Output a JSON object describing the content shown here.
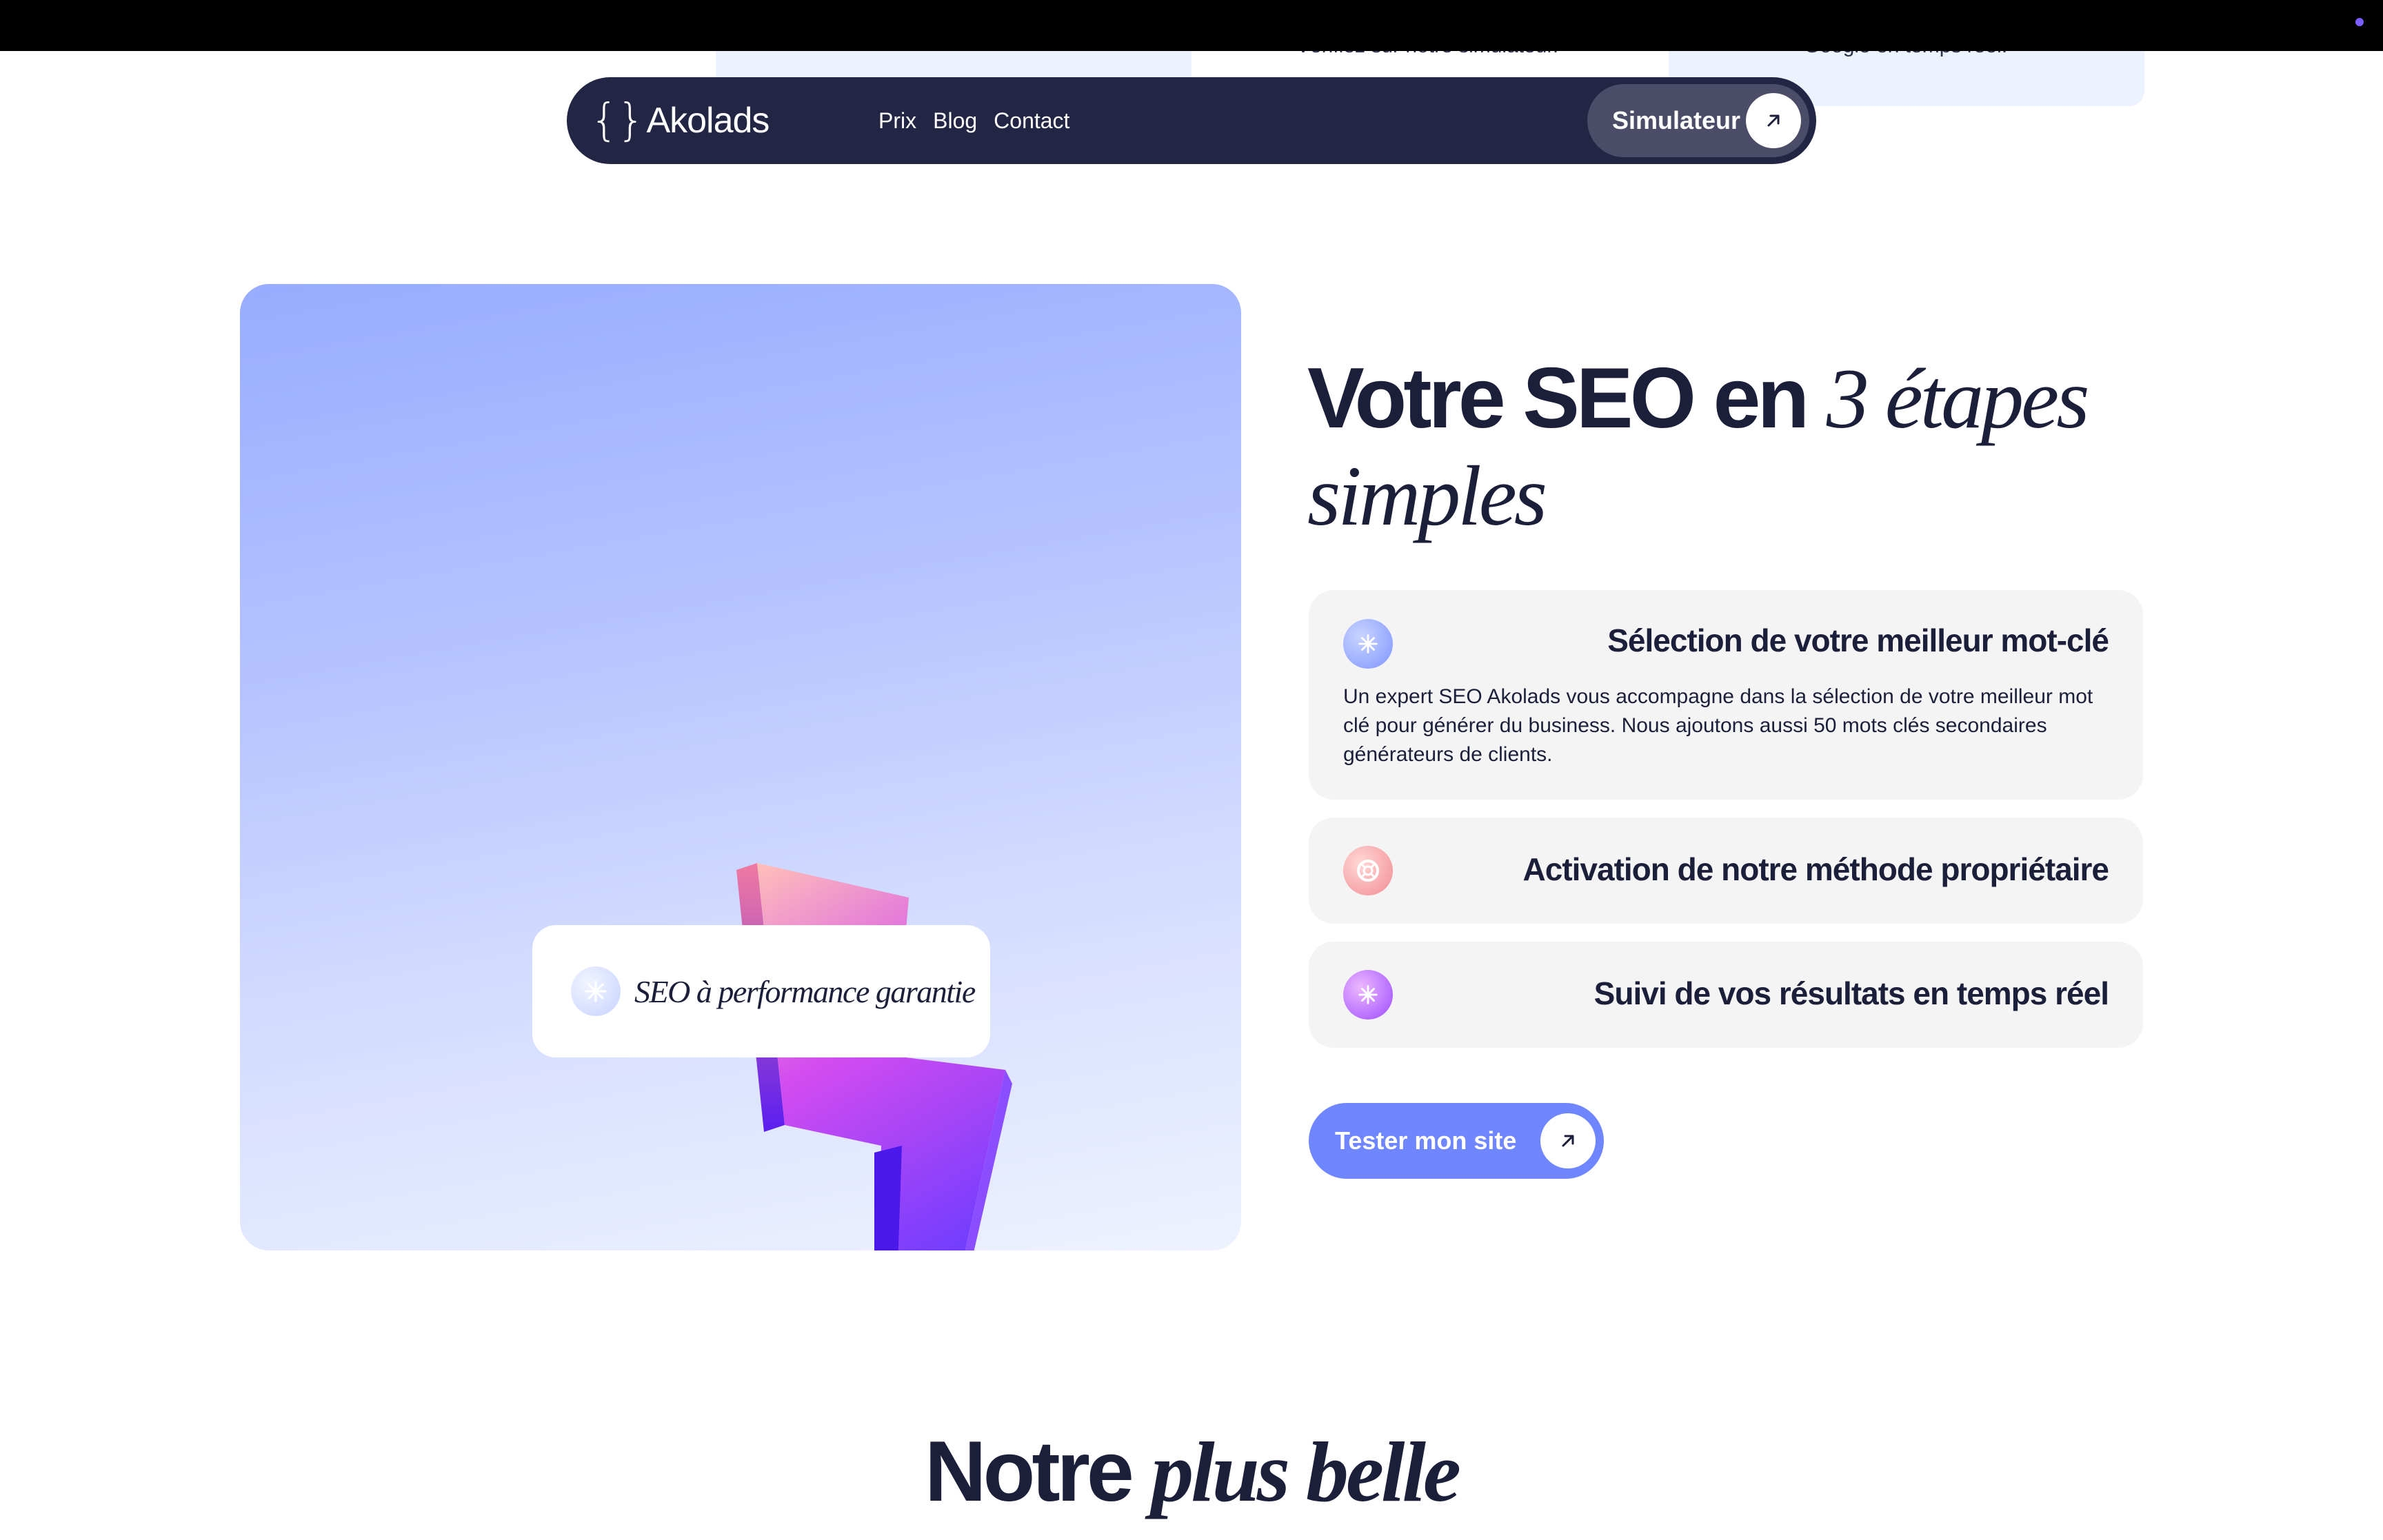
{
  "peek": {
    "left_text": "Vérifiez sur notre simulateur.",
    "right_text": "Google en temps réel."
  },
  "nav": {
    "logo_braces": "{}",
    "logo_text": "Akolads",
    "links": [
      "Prix",
      "Blog",
      "Contact"
    ],
    "cta_label": "Simulateur"
  },
  "hero": {
    "badge_text": "SEO à performance garantie",
    "heading_plain": "Votre SEO en",
    "heading_italic_1": "3 étapes",
    "heading_italic_2": "simples"
  },
  "steps": [
    {
      "title": "Sélection de votre meilleur mot-clé",
      "description": "Un expert SEO Akolads vous accompagne dans la sélection de votre meilleur mot clé pour générer du business. Nous ajoutons aussi 50 mots clés secondaires générateurs de clients.",
      "icon": "sparkle-icon",
      "color": "#7f95ff"
    },
    {
      "title": "Activation de notre méthode propriétaire",
      "icon": "lifebuoy-icon",
      "color": "#f28b94"
    },
    {
      "title": "Suivi de vos résultats en temps réel",
      "icon": "sparkle-icon",
      "color": "#9d4bff"
    }
  ],
  "cta": {
    "label": "Tester mon site"
  },
  "section2": {
    "heading_plain": "Notre",
    "heading_italic": "plus belle"
  },
  "colors": {
    "navy": "#222543",
    "accent": "#6f86ff",
    "text": "#1c1f3a"
  }
}
